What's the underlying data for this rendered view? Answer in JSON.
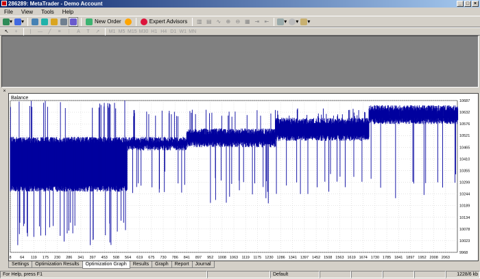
{
  "window": {
    "title": "286289: MetaTrader - Demo Account"
  },
  "menu": [
    "File",
    "View",
    "Tools",
    "Help"
  ],
  "toolbar": {
    "new_order": "New Order",
    "expert_advisors": "Expert Advisors"
  },
  "tester": {
    "close_glyph": "×",
    "tabs": [
      {
        "label": "Settings",
        "active": false
      },
      {
        "label": "Optimization Results",
        "active": false
      },
      {
        "label": "Optimization Graph",
        "active": true
      },
      {
        "label": "Results",
        "active": false
      },
      {
        "label": "Graph",
        "active": false
      },
      {
        "label": "Report",
        "active": false
      },
      {
        "label": "Journal",
        "active": false
      }
    ]
  },
  "statusbar": {
    "help": "For Help, press F1",
    "profile": "Default",
    "traffic": "1228/6 kb"
  },
  "chart_data": {
    "type": "bar",
    "title": "Balance",
    "color": "#00009e",
    "grid": true,
    "y_ticks": [
      "10687",
      "10632",
      "10576",
      "10521",
      "10465",
      "10410",
      "10355",
      "10299",
      "10244",
      "10189",
      "10134",
      "10078",
      "10023",
      "9968"
    ],
    "ylim": [
      9968,
      10687
    ],
    "x_ticks": [
      "8",
      "64",
      "119",
      "175",
      "230",
      "286",
      "341",
      "397",
      "453",
      "508",
      "564",
      "619",
      "675",
      "730",
      "786",
      "841",
      "897",
      "952",
      "1008",
      "1063",
      "1119",
      "1175",
      "1230",
      "1286",
      "1341",
      "1397",
      "1452",
      "1508",
      "1563",
      "1619",
      "1674",
      "1730",
      "1785",
      "1841",
      "1897",
      "1952",
      "2008",
      "2063"
    ],
    "x_start": 8,
    "x_step": 55.5,
    "n_passes": 2100,
    "segments": [
      {
        "from": 8,
        "to": 560,
        "low": 10270,
        "high": 10500,
        "extremes": [
          10000,
          10687
        ]
      },
      {
        "from": 560,
        "to": 840,
        "low": 10465,
        "high": 10500,
        "extremes": [
          10240,
          10650
        ]
      },
      {
        "from": 840,
        "to": 1260,
        "low": 10480,
        "high": 10540,
        "extremes": [
          10200,
          10650
        ]
      },
      {
        "from": 1260,
        "to": 1700,
        "low": 10510,
        "high": 10590,
        "extremes": [
          10230,
          10650
        ]
      },
      {
        "from": 1700,
        "to": 2120,
        "low": 10590,
        "high": 10650,
        "extremes": [
          10220,
          10650
        ]
      }
    ]
  }
}
